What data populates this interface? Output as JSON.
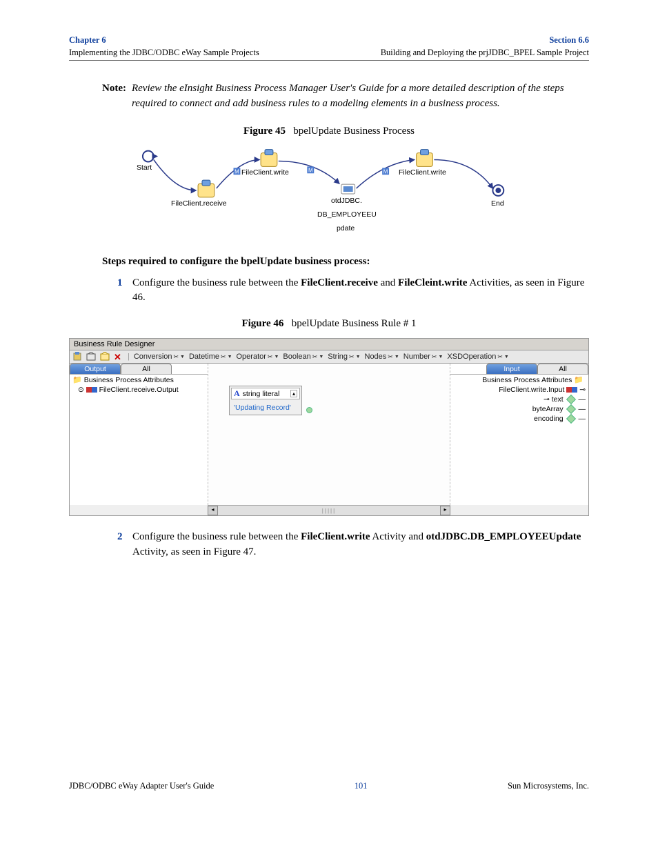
{
  "header": {
    "chapter": "Chapter 6",
    "chapter_sub": "Implementing the JDBC/ODBC eWay Sample Projects",
    "section": "Section 6.6",
    "section_sub": "Building and Deploying the prjJDBC_BPEL Sample Project"
  },
  "note": {
    "label": "Note:",
    "text": "Review the eInsight Business Process Manager User's Guide for a more detailed description of the steps required to connect and add business rules to a modeling elements in a business process."
  },
  "fig45": {
    "caption_strong": "Figure 45",
    "caption_rest": "bpelUpdate Business Process",
    "nodes": {
      "start": "Start",
      "receive": "FileClient.receive",
      "write1": "FileClient.write",
      "update": "otdJDBC.",
      "update2": "DB_EMPLOYEEU",
      "update3": "pdate",
      "write2": "FileClient.write",
      "end": "End"
    }
  },
  "steps_title": "Steps required to configure the bpelUpdate business process:",
  "step1": {
    "num": "1",
    "pre": "Configure the business rule between the ",
    "bold1": "FileClient.receive",
    "mid": " and ",
    "bold2": "FileCleint.write",
    "post": " Activities, as seen in Figure 46."
  },
  "fig46": {
    "caption_strong": "Figure 46",
    "caption_rest": "bpelUpdate Business Rule # 1",
    "title": "Business Rule Designer",
    "toolbar_menus": [
      "Conversion",
      "Datetime",
      "Operator",
      "Boolean",
      "String",
      "Nodes",
      "Number",
      "XSDOperation"
    ],
    "left": {
      "tab_active": "Output",
      "tab_other": "All",
      "tree_root": "Business Process Attributes",
      "tree_child": "FileClient.receive.Output"
    },
    "right": {
      "tab_active": "Input",
      "tab_other": "All",
      "tree_root": "Business Process Attributes",
      "tree_child": "FileClient.write.Input",
      "leaf1": "text",
      "leaf2": "byteArray",
      "leaf3": "encoding"
    },
    "literal": {
      "label": "string literal",
      "value": "'Updating Record'"
    }
  },
  "step2": {
    "num": "2",
    "pre": "Configure the business rule between the ",
    "bold1": "FileClient.write",
    "mid": " Activity and ",
    "bold2": "otdJDBC.DB_EMPLOYEEUpdate",
    "post": " Activity, as seen in Figure 47."
  },
  "footer": {
    "left": "JDBC/ODBC eWay Adapter User's Guide",
    "center": "101",
    "right": "Sun Microsystems, Inc."
  }
}
